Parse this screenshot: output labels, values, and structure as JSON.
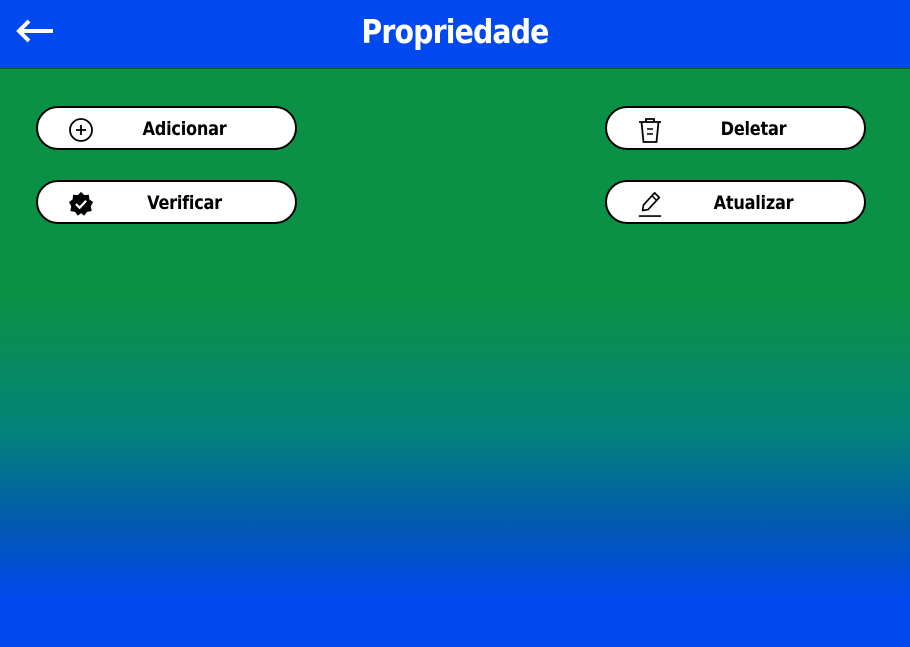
{
  "header": {
    "title": "Propriedade",
    "back_icon": "arrow-left-icon",
    "background": "#0149ef"
  },
  "actions": {
    "add": {
      "label": "Adicionar",
      "icon": "plus-circle-icon"
    },
    "verify": {
      "label": "Verificar",
      "icon": "verified-badge-icon"
    },
    "delete": {
      "label": "Deletar",
      "icon": "trash-icon"
    },
    "update": {
      "label": "Atualizar",
      "icon": "pencil-icon"
    }
  },
  "colors": {
    "green": "#0b9146",
    "blue": "#0149ef",
    "button_bg": "#ffffff"
  }
}
